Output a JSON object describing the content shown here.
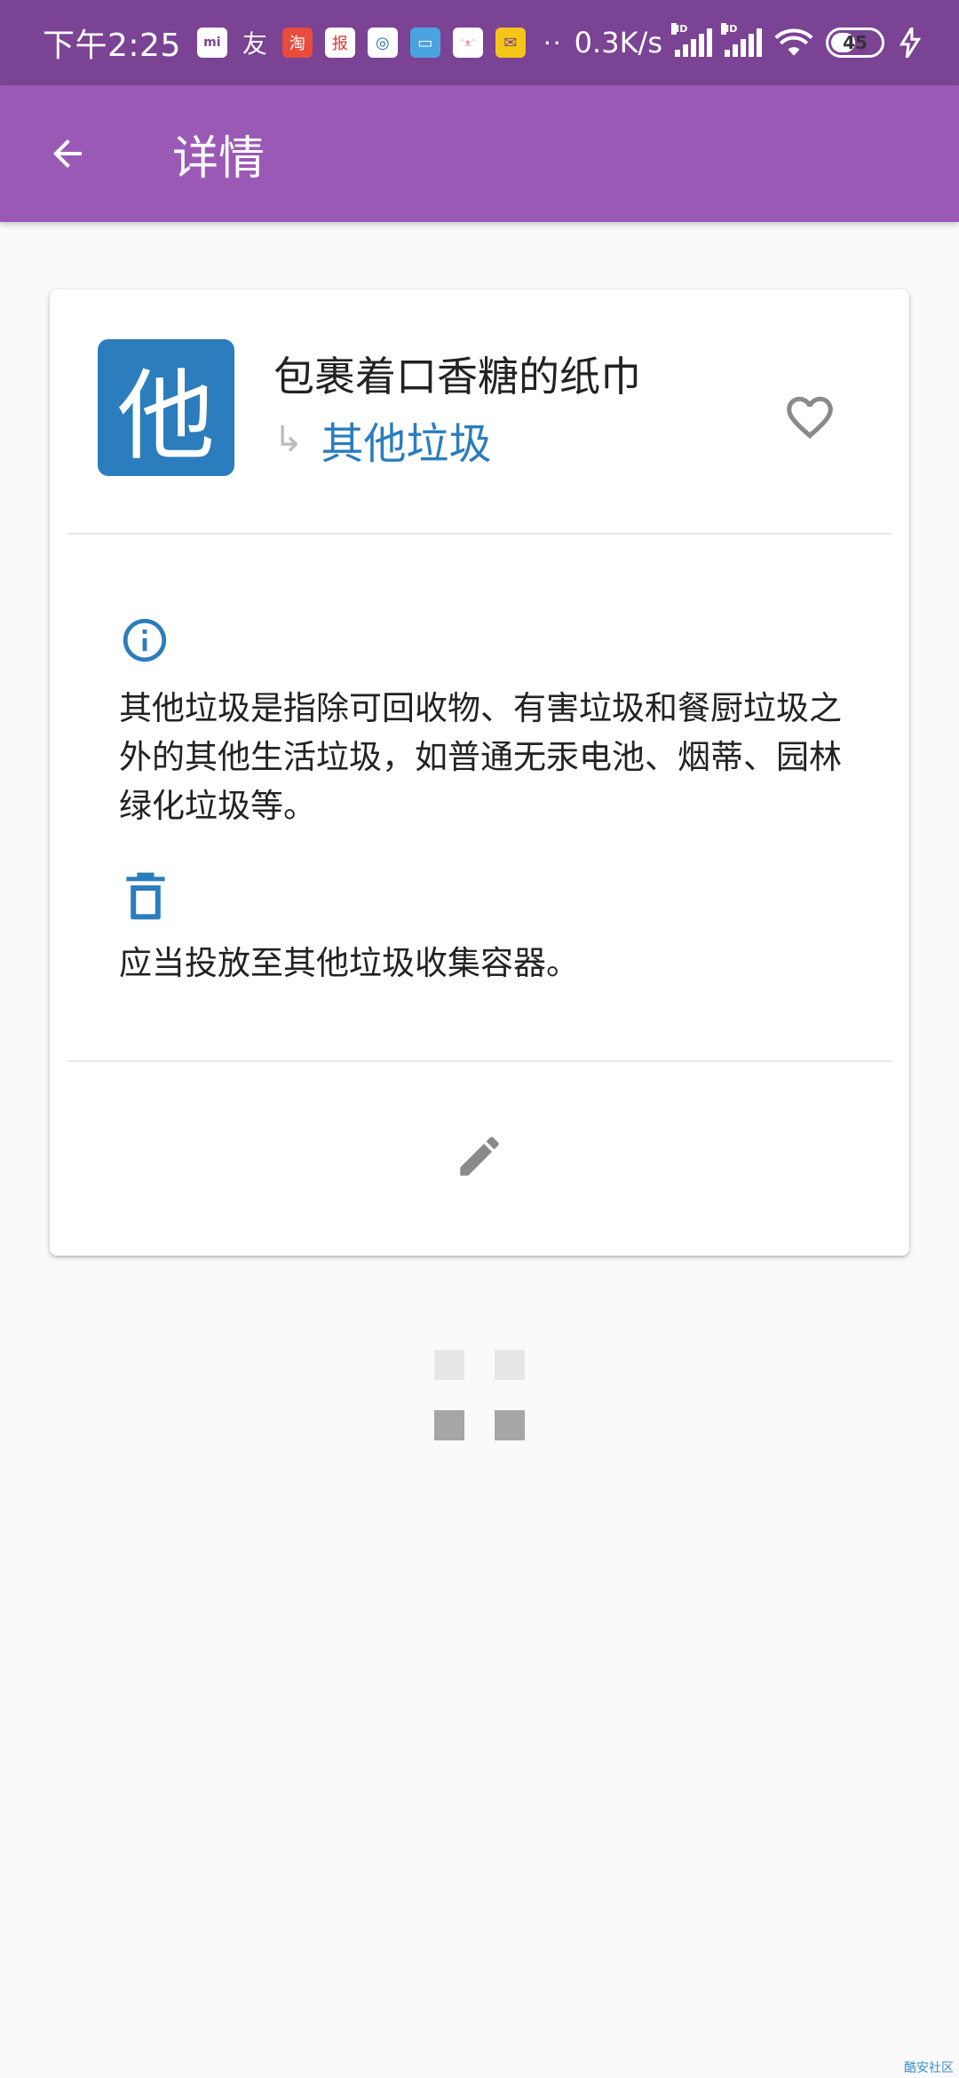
{
  "status_bar": {
    "time": "下午2:25",
    "notifications": [
      {
        "icon": "mi-app-icon",
        "label": "mi",
        "color": "#ffffff"
      },
      {
        "icon": "friend-app-icon",
        "label": "友",
        "color": "#7b4394"
      },
      {
        "icon": "taobao-app-icon",
        "label": "淘",
        "color": "#e84c3d"
      },
      {
        "icon": "news-app-icon",
        "label": "报",
        "color": "#d33"
      },
      {
        "icon": "circle-app-icon",
        "label": "◎",
        "color": "#2b6cb0"
      },
      {
        "icon": "file-app-icon",
        "label": "▭",
        "color": "#4aa3df"
      },
      {
        "icon": "bilibili-app-icon",
        "label": "ᵔᴥᵔ",
        "color": "#f093b0"
      },
      {
        "icon": "mail-app-icon",
        "label": "✉",
        "color": "#f5c518"
      }
    ],
    "more": "··",
    "net_speed": "0.3K/s",
    "hd1": "HD",
    "hd2": "HD",
    "battery": "45"
  },
  "app_bar": {
    "title": "详情"
  },
  "card": {
    "category_badge": "他",
    "item_name": "包裹着口香糖的纸巾",
    "category_arrow": "↳",
    "category_name": "其他垃圾",
    "description": "其他垃圾是指除可回收物、有害垃圾和餐厨垃圾之外的其他生活垃圾，如普通无汞电池、烟蒂、园林绿化垃圾等。",
    "instruction": "应当投放至其他垃圾收集容器。"
  },
  "colors": {
    "status_bar": "#7b4394",
    "app_bar": "#9b59b6",
    "accent": "#2b7dbd",
    "icon_gray": "#8a8a8a"
  },
  "watermark": "酷安社区"
}
